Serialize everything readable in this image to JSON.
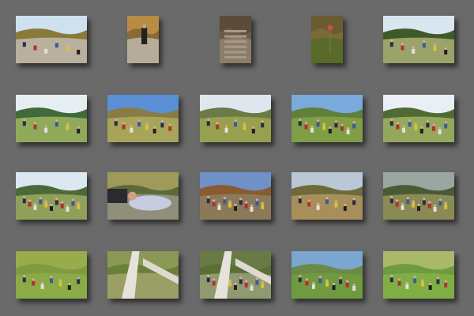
{
  "gallery": {
    "photos": [
      {
        "id": "r1c1",
        "orientation": "landscape",
        "scene": "hikers-trail",
        "sky": "#cfe0ee",
        "top": "#8a7a3a",
        "ground": "#b9b0a0"
      },
      {
        "id": "r1c2",
        "orientation": "portrait",
        "scene": "hiker-path",
        "sky": "#b78d45",
        "top": "#8b6a35",
        "ground": "#b5ad9a"
      },
      {
        "id": "r1c3",
        "orientation": "portrait",
        "scene": "stone-steps",
        "sky": "#5c4a3a",
        "top": "#6e5a45",
        "ground": "#8c7c6a"
      },
      {
        "id": "r1c4",
        "orientation": "portrait",
        "scene": "flower-closeup",
        "sky": "#6a5a30",
        "top": "#7a6a38",
        "ground": "#5a6a2a"
      },
      {
        "id": "r1c5",
        "orientation": "landscape",
        "scene": "group-meadow",
        "sky": "#d9e6ef",
        "top": "#3f5a2a",
        "ground": "#9aa36a"
      },
      {
        "id": "r2c1",
        "orientation": "landscape",
        "scene": "picnic-group",
        "sky": "#e7eef2",
        "top": "#3f6a3a",
        "ground": "#8faa5a"
      },
      {
        "id": "r2c2",
        "orientation": "landscape",
        "scene": "meadow-blanket",
        "sky": "#5a8fd6",
        "top": "#8a7a45",
        "ground": "#a7a55a"
      },
      {
        "id": "r2c3",
        "orientation": "landscape",
        "scene": "resting-group",
        "sky": "#dfe7ee",
        "top": "#6c7a48",
        "ground": "#96a04e"
      },
      {
        "id": "r2c4",
        "orientation": "landscape",
        "scene": "green-hill",
        "sky": "#7aa9dc",
        "top": "#5f7f3a",
        "ground": "#7f9e45"
      },
      {
        "id": "r2c5",
        "orientation": "landscape",
        "scene": "group-hill",
        "sky": "#e9eff4",
        "top": "#4f6b35",
        "ground": "#93a85a"
      },
      {
        "id": "r3c1",
        "orientation": "landscape",
        "scene": "trees-group",
        "sky": "#dce7ef",
        "top": "#4a6a38",
        "ground": "#8fa05a"
      },
      {
        "id": "r3c2",
        "orientation": "landscape",
        "scene": "lying-person",
        "sky": "#a09a5a",
        "top": "#5a6a3a",
        "ground": "#8f8f7a"
      },
      {
        "id": "r3c3",
        "orientation": "landscape",
        "scene": "autumn-hill",
        "sky": "#6f91c8",
        "top": "#8a5a30",
        "ground": "#8b7a5a"
      },
      {
        "id": "r3c4",
        "orientation": "landscape",
        "scene": "sitting-crowd",
        "sky": "#bac8d6",
        "top": "#6e6a3a",
        "ground": "#a68f5a"
      },
      {
        "id": "r3c5",
        "orientation": "landscape",
        "scene": "slope-crowd",
        "sky": "#9aa6a0",
        "top": "#4a5a35",
        "ground": "#8a8a55"
      },
      {
        "id": "r4c1",
        "orientation": "landscape",
        "scene": "distant-group",
        "sky": "#98ad4a",
        "top": "#7f9a40",
        "ground": "#8aab45"
      },
      {
        "id": "r4c2",
        "orientation": "landscape",
        "scene": "stone-wall",
        "sky": "#8a9a55",
        "top": "#6a7f3a",
        "ground": "#9aa065"
      },
      {
        "id": "r4c3",
        "orientation": "landscape",
        "scene": "wall-hikers",
        "sky": "#6a7a45",
        "top": "#5a6f35",
        "ground": "#8f9a70"
      },
      {
        "id": "r4c4",
        "orientation": "landscape",
        "scene": "bench-row",
        "sky": "#7aa6cf",
        "top": "#6a8a45",
        "ground": "#6f9a40"
      },
      {
        "id": "r4c5",
        "orientation": "landscape",
        "scene": "long-row",
        "sky": "#aab86a",
        "top": "#6e9a40",
        "ground": "#7fae45"
      }
    ]
  }
}
